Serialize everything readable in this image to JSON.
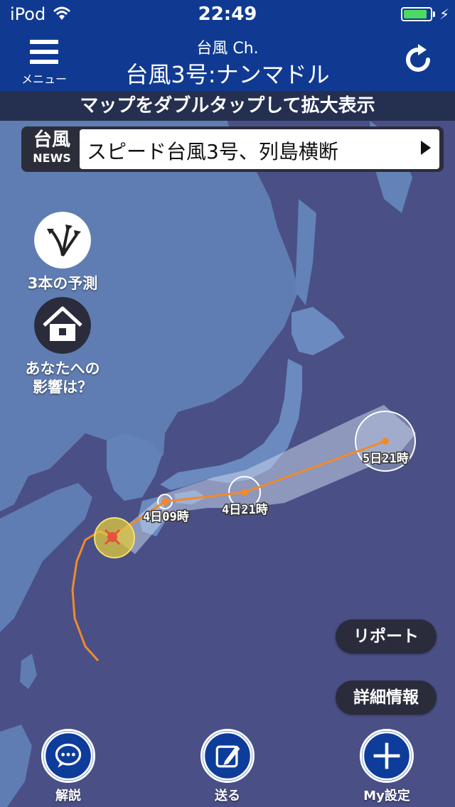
{
  "status_bar": {
    "carrier": "iPod",
    "time": "22:49",
    "wifi_icon": "wifi-icon",
    "battery_icon": "battery-icon",
    "battery_level": 0.9,
    "charging_icon": "charging-bolt-icon"
  },
  "nav": {
    "menu_label": "メニュー",
    "menu_icon": "hamburger-menu-icon",
    "title_small": "台風 Ch.",
    "title_main": "台風3号:ナンマドル",
    "refresh_icon": "refresh-icon"
  },
  "hint": {
    "text": "マップをダブルタップして拡大表示"
  },
  "news": {
    "badge_kanji": "台風",
    "badge_en": "NEWS",
    "headline": "スピード台風3号、列島横断",
    "arrow_icon": "play-arrow-icon"
  },
  "side_buttons": {
    "forecast_label": "3本の予測",
    "forecast_icon": "three-arrows-icon",
    "impact_label_1": "あなたへの",
    "impact_label_2": "影響は？",
    "impact_icon": "house-icon"
  },
  "track": {
    "points": [
      {
        "label": "4日09時"
      },
      {
        "label": "4日21時"
      },
      {
        "label": "5日21時"
      }
    ],
    "current_icon": "typhoon-position-icon",
    "colors": {
      "track": "#f08a2c",
      "cone": "#c6d3ea",
      "storm_zone": "#e2c93e",
      "center": "#e5533b"
    }
  },
  "pill_buttons": {
    "report": "リポート",
    "details": "詳細情報"
  },
  "bottom_nav": {
    "commentary_label": "解説",
    "commentary_icon": "speech-bubble-icon",
    "send_label": "送る",
    "send_icon": "edit-pencil-icon",
    "settings_label": "My設定",
    "settings_icon": "plus-icon"
  },
  "colors": {
    "nav": "#103a92",
    "sea": "#4a4f86",
    "land": "#5f7db2"
  }
}
